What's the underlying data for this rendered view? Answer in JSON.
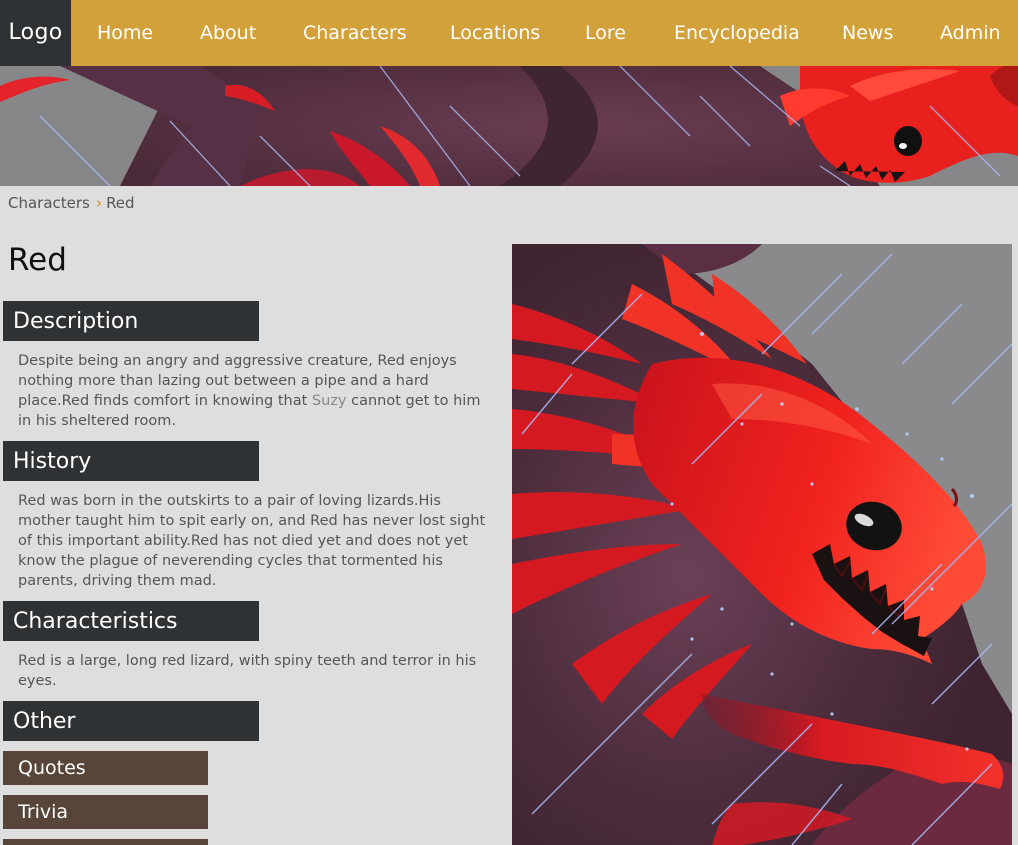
{
  "nav": {
    "logo": "Logo",
    "items": [
      "Home",
      "About",
      "Characters",
      "Locations",
      "Lore",
      "Encyclopedia",
      "News",
      "Admin"
    ]
  },
  "breadcrumb": {
    "parent": "Characters",
    "separator": "›",
    "current": "Red"
  },
  "page": {
    "title": "Red"
  },
  "sections": {
    "description": {
      "heading": "Description",
      "text_before": "Despite being an angry and aggressive creature, Red enjoys nothing more than lazing out between a pipe and a hard place.Red finds comfort in knowing that ",
      "highlight": "Suzy",
      "text_after": " cannot get to him in his sheltered room."
    },
    "history": {
      "heading": "History",
      "text": "Red was born in the outskirts to a pair of loving lizards.His mother taught him to spit early on, and Red has never lost sight of this important ability.Red has not died yet and does not yet know the plague of neverending cycles that tormented his parents, driving them mad."
    },
    "characteristics": {
      "heading": "Characteristics",
      "text": "Red is a large, long red lizard, with spiny teeth and terror in his eyes."
    },
    "other": {
      "heading": "Other",
      "buttons": [
        "Quotes",
        "Trivia"
      ]
    }
  },
  "colors": {
    "nav_bg": "#d3a13a",
    "dark": "#2f3235",
    "button_bg": "#564538",
    "page_bg": "#dedede",
    "creature_red": "#e51a1a"
  }
}
